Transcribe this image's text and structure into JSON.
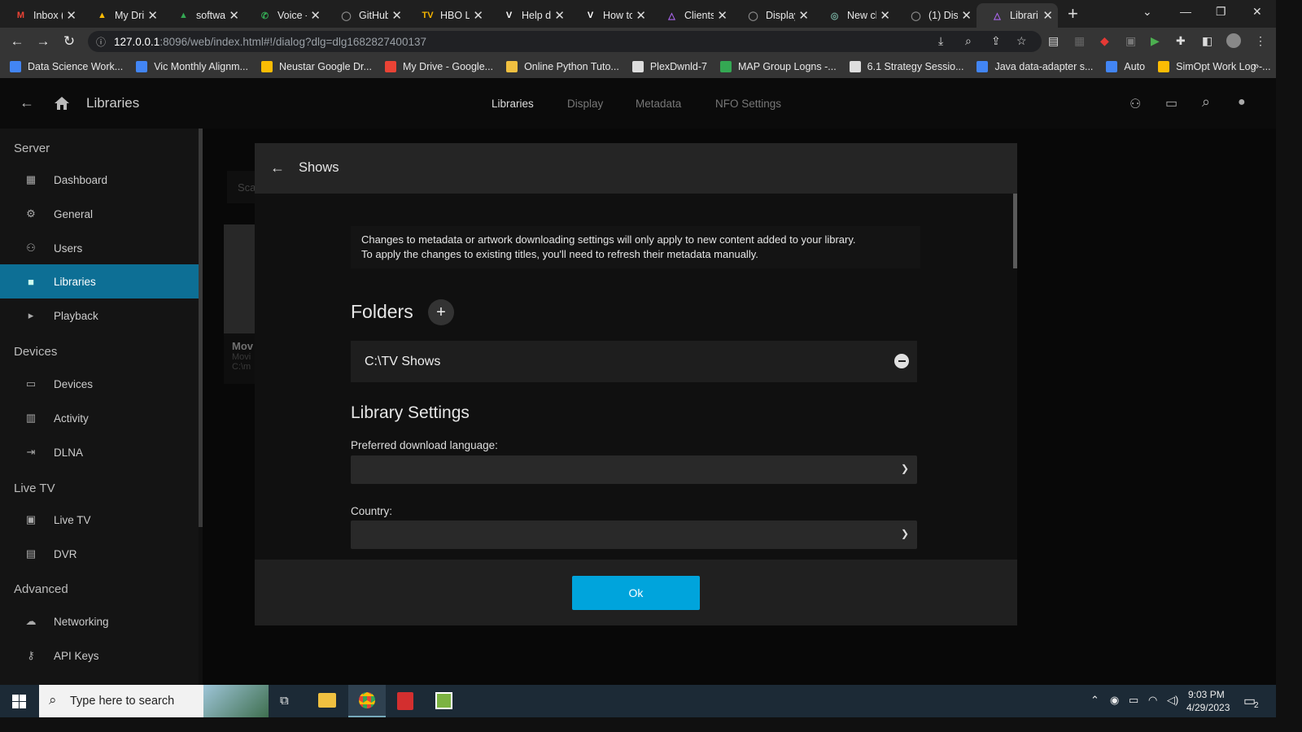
{
  "browser": {
    "tabs": [
      {
        "label": "Inbox (",
        "icon": "gmail-icon",
        "color": "#ea4335",
        "glyph": "M"
      },
      {
        "label": "My Dri",
        "icon": "google-drive-icon",
        "color": "#fbbc04",
        "glyph": "▲"
      },
      {
        "label": "softwa",
        "icon": "google-drive-icon",
        "color": "#34a853",
        "glyph": "▲"
      },
      {
        "label": "Voice -",
        "icon": "phone-icon",
        "color": "#34a853",
        "glyph": "✆"
      },
      {
        "label": "GitHub",
        "icon": "github-icon",
        "color": "#888888",
        "glyph": "◯"
      },
      {
        "label": "HBO Li",
        "icon": "tv-icon",
        "color": "#f4b400",
        "glyph": "TV"
      },
      {
        "label": "Help d",
        "icon": "vimeo-icon",
        "color": "#ffffff",
        "glyph": "V"
      },
      {
        "label": "How to",
        "icon": "vimeo-icon",
        "color": "#ffffff",
        "glyph": "V"
      },
      {
        "label": "Clients",
        "icon": "jellyfin-icon",
        "color": "#aa66ee",
        "glyph": "△"
      },
      {
        "label": "Display",
        "icon": "github-icon",
        "color": "#888888",
        "glyph": "◯"
      },
      {
        "label": "New cl",
        "icon": "openai-icon",
        "color": "#74aa9c",
        "glyph": "◎"
      },
      {
        "label": "(1) Dis",
        "icon": "github-icon",
        "color": "#888888",
        "glyph": "◯"
      },
      {
        "label": "Librari",
        "icon": "jellyfin-icon",
        "color": "#aa66ee",
        "glyph": "△",
        "active": true
      }
    ],
    "url_host": "127.0.0.1",
    "url_path": ":8096/web/index.html#!/dialog?dlg=dlg1682827400137",
    "bookmarks": [
      {
        "label": "Data Science Work...",
        "color": "#4285f4"
      },
      {
        "label": "Vic Monthly Alignm...",
        "color": "#4285f4"
      },
      {
        "label": "Neustar Google Dr...",
        "color": "#fbbc04"
      },
      {
        "label": "My Drive - Google...",
        "color": "#ea4335"
      },
      {
        "label": "Online Python Tuto...",
        "color": "#f0c040"
      },
      {
        "label": "PlexDwnld-7",
        "color": "#dddddd"
      },
      {
        "label": "MAP Group Logns -...",
        "color": "#34a853"
      },
      {
        "label": "6.1 Strategy Sessio...",
        "color": "#dddddd"
      },
      {
        "label": "Java data-adapter s...",
        "color": "#4285f4"
      },
      {
        "label": "Auto",
        "color": "#4285f4"
      },
      {
        "label": "SimOpt Work Log -...",
        "color": "#fbbc04"
      }
    ]
  },
  "app": {
    "title": "Libraries",
    "nav": [
      "Libraries",
      "Display",
      "Metadata",
      "NFO Settings"
    ]
  },
  "sidebar": {
    "sections": [
      {
        "title": "Server",
        "items": [
          "Dashboard",
          "General",
          "Users",
          "Libraries",
          "Playback"
        ]
      },
      {
        "title": "Devices",
        "items": [
          "Devices",
          "Activity",
          "DLNA"
        ]
      },
      {
        "title": "Live TV",
        "items": [
          "Live TV",
          "DVR"
        ]
      },
      {
        "title": "Advanced",
        "items": [
          "Networking",
          "API Keys"
        ]
      }
    ]
  },
  "background": {
    "scan_button": "Sca",
    "card_title": "Mov",
    "card_sub1": "Movi",
    "card_sub2": "C:\\m"
  },
  "dialog": {
    "title": "Shows",
    "notice_line1": "Changes to metadata or artwork downloading settings will only apply to new content added to your library.",
    "notice_line2": "To apply the changes to existing titles, you'll need to refresh their metadata manually.",
    "folders_heading": "Folders",
    "folder_path": "C:\\TV Shows",
    "settings_heading": "Library Settings",
    "language_label": "Preferred download language:",
    "language_value": "",
    "country_label": "Country:",
    "country_value": "",
    "ok_label": "Ok"
  },
  "taskbar": {
    "search_placeholder": "Type here to search",
    "time": "9:03 PM",
    "date": "4/29/2023",
    "notification_count": "2"
  }
}
